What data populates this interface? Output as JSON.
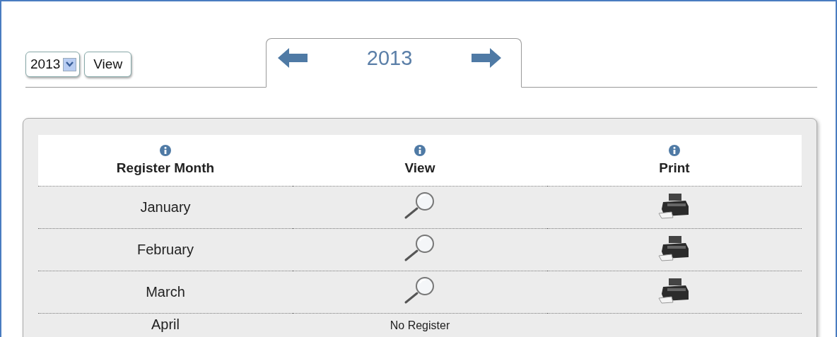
{
  "year_select": {
    "value": "2013"
  },
  "view_button": "View",
  "year_tab": {
    "label": "2013"
  },
  "table": {
    "columns": [
      {
        "label": "Register Month"
      },
      {
        "label": "View"
      },
      {
        "label": "Print"
      }
    ],
    "rows": [
      {
        "month": "January",
        "kind": "register"
      },
      {
        "month": "February",
        "kind": "register"
      },
      {
        "month": "March",
        "kind": "register"
      },
      {
        "month": "April",
        "kind": "none",
        "status": "No Register"
      }
    ]
  }
}
